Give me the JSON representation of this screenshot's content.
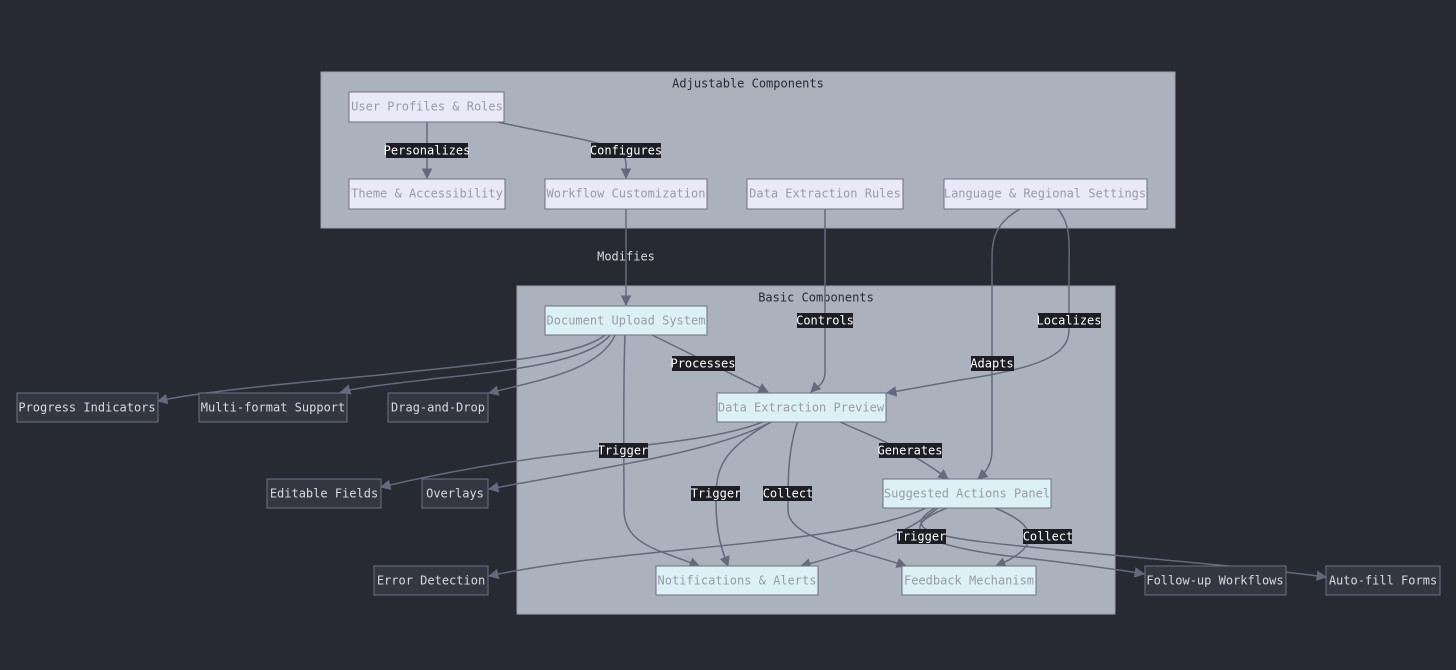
{
  "clusters": {
    "adjustable": {
      "title": "Adjustable Components"
    },
    "basic": {
      "title": "Basic Components"
    }
  },
  "nodes": {
    "user_profiles": "User Profiles & Roles",
    "theme": "Theme & Accessibility",
    "workflow_custom": "Workflow Customization",
    "extraction_rules": "Data Extraction Rules",
    "language": "Language & Regional Settings",
    "doc_upload": "Document Upload System",
    "extraction_preview": "Data Extraction Preview",
    "suggested_actions": "Suggested Actions Panel",
    "notifications": "Notifications & Alerts",
    "feedback": "Feedback Mechanism",
    "progress": "Progress Indicators",
    "multiformat": "Multi-format Support",
    "dragdrop": "Drag-and-Drop",
    "editable": "Editable Fields",
    "overlays": "Overlays",
    "error_detection": "Error Detection",
    "followup": "Follow-up Workflows",
    "autofill": "Auto-fill Forms"
  },
  "edge_labels": {
    "personalizes": "Personalizes",
    "configures": "Configures",
    "modifies": "Modifies",
    "controls": "Controls",
    "localizes": "Localizes",
    "adapts": "Adapts",
    "processes": "Processes",
    "generates": "Generates",
    "trigger_upload": "Trigger",
    "trigger_preview": "Trigger",
    "collect_preview": "Collect",
    "trigger_actions": "Trigger",
    "collect_actions": "Collect"
  },
  "colors": {
    "background": "#272a33",
    "cluster_fill": "#abb1bd",
    "node_light": "#e9e9f7",
    "node_cyan": "#dbf1f5",
    "node_dark": "#343741",
    "edge": "#646a7b"
  }
}
